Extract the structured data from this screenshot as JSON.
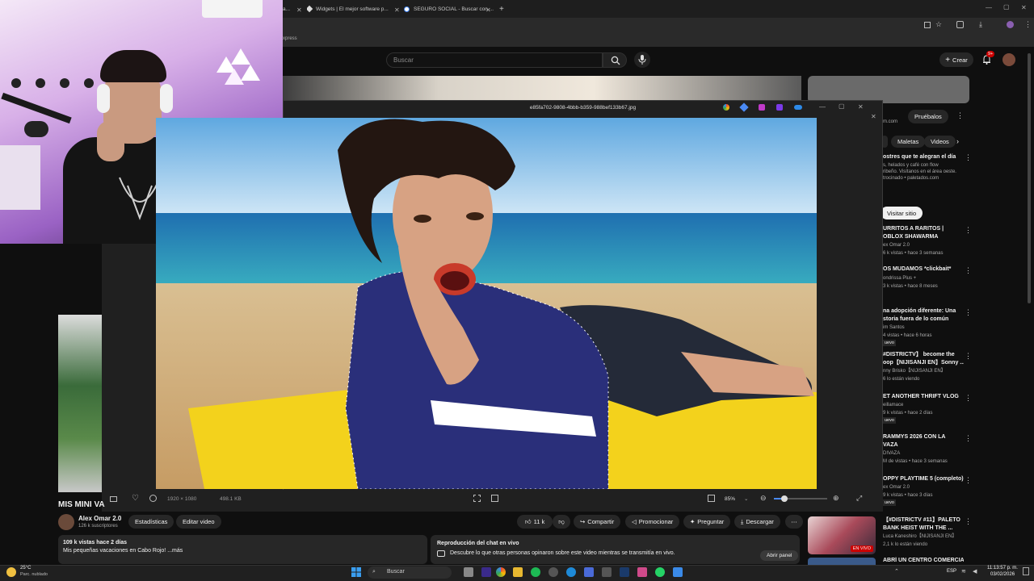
{
  "browser": {
    "tabs": [
      {
        "label": "a..."
      },
      {
        "label": "Widgets | El mejor software p..."
      },
      {
        "label": "SEGURO SOCIAL - Buscar con ..."
      }
    ],
    "bookmark_text": "xpress",
    "new_tab": "+",
    "win_min": "—",
    "win_max": "▢",
    "win_close": "✕"
  },
  "youtube": {
    "search_placeholder": "Buscar",
    "create_label": "Crear",
    "notif_count": "9+",
    "ad": {
      "domain_fragment": "m.com",
      "cta_label": "Pruébalos",
      "chips": [
        "Maletas",
        "Videos"
      ],
      "title": "ostres que te alegran el día",
      "desc_line1": "s, helados y café con flow",
      "desc_line2": "ribeño. Visítanos en el área oeste.",
      "sponsor": "trocinado • paletados.com",
      "visit_label": "Visitar sitio"
    },
    "recommendations": [
      {
        "title": "URRITOS A RARITOS |",
        "title2": "OBLOX SHAWARMA",
        "meta1": "ex Omar 2.0",
        "meta2": "6 k vistas • hace 3 semanas"
      },
      {
        "title": "OS MUDAMOS *clickbait*",
        "title2": "",
        "meta1": "ondrissa Plus +",
        "meta2": "3 k vistas • hace 8 meses"
      },
      {
        "title": "na adopción diferente: Una",
        "title2": "storia fuera de lo común",
        "meta1": "im Santos",
        "meta2": "4 vistas • hace 6 horas"
      },
      {
        "title": "#DISTRICTV】 become the",
        "title2": "oop【NIJISANJI EN】Sonny ...",
        "meta1": "nny Brisko【NIJISANJI EN】",
        "meta2": "6 lo están viendo"
      },
      {
        "title": "ET ANOTHER THRIFT VLOG",
        "title2": "",
        "meta1": "eillamace",
        "meta2": "9 k vistas • hace 2 días"
      },
      {
        "title": "RAMMYS 2026 CON LA",
        "title2": "VAZA",
        "meta1": "DIVAZA",
        "meta2": "M de vistas • hace 3 semanas"
      },
      {
        "title": "OPPY PLAYTIME 5 (completo)",
        "title2": "",
        "meta1": "ex Omar 2.0",
        "meta2": "9 k vistas • hace 3 días"
      }
    ],
    "badge_nuevo": "uevo",
    "live_card": {
      "title1": "【#DISTRICTV #11】PALETO",
      "title2": "BANK HEIST WITH THE ...",
      "channel": "Luca Kaneshiro【NIJISANJI EN】",
      "viewers": "2,1 k lo están viendo",
      "live_badge": "EN VIVO"
    },
    "next_title": "ABRÍ UN CENTRO COMERCIAL"
  },
  "viewer": {
    "filename": "e85fa702-9808-4bbb-b359-988bef133b67.jpg",
    "dimensions": "1920 × 1080",
    "filesize": "498.1 KB",
    "zoom": "85%",
    "zoom_fraction": 0.2
  },
  "video": {
    "title": "MIS MINI VA",
    "channel": "Alex Omar 2.0",
    "subs": "126 k suscriptores",
    "btn_stats": "Estadísticas",
    "btn_edit": "Editar video",
    "likes": "11 k",
    "btn_share": "Compartir",
    "btn_promote": "Promocionar",
    "btn_ask": "Preguntar",
    "btn_download": "Descargar",
    "views_line": "109 k vistas  hace 2 días",
    "desc_line": "Mis pequeñas vacaciones en Cabo Rojo! ...más",
    "chat_title": "Reproducción del chat en vivo",
    "chat_desc": "Descubre lo que otras personas opinaron sobre este video mientras se transmitía en vivo.",
    "chat_btn": "Abrir panel"
  },
  "taskbar": {
    "weather_temp": "25°C",
    "weather_desc": "Parc. nublado",
    "search_label": "Buscar",
    "lang": "ESP",
    "time": "11:13:57 p. m.",
    "date": "03/02/2026"
  },
  "colors": {
    "accent_red": "#ff0000",
    "yt_bg": "#0f0f0f",
    "pill_bg": "#272727",
    "viewer_bg": "#202020"
  }
}
